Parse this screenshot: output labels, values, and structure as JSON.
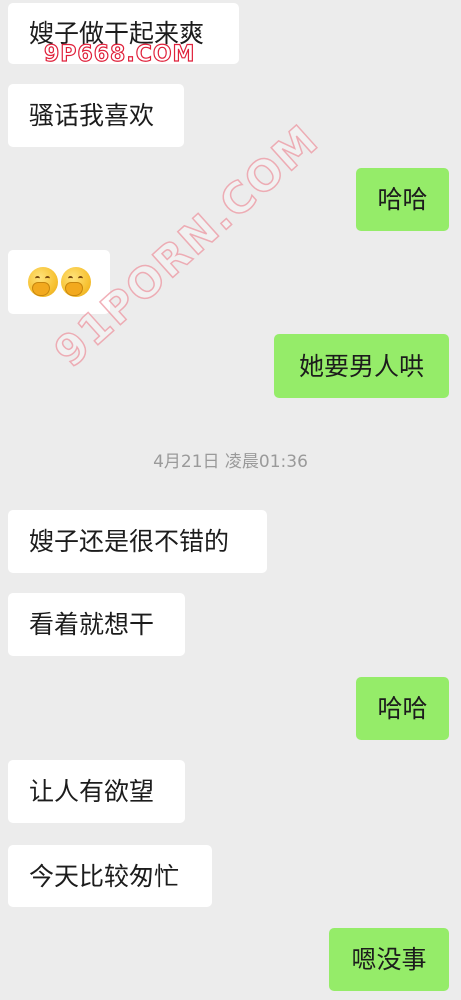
{
  "messages": [
    {
      "side": "in",
      "text": "嫂子做干起来爽"
    },
    {
      "side": "in",
      "text": "骚话我喜欢"
    },
    {
      "side": "out",
      "text": "哈哈"
    },
    {
      "side": "in",
      "emoji": [
        "hand-over-mouth-emoji",
        "hand-over-mouth-emoji"
      ]
    },
    {
      "side": "out",
      "text": "她要男人哄"
    },
    {
      "side": "in",
      "text": "嫂子还是很不错的"
    },
    {
      "side": "in",
      "text": "看着就想干"
    },
    {
      "side": "out",
      "text": "哈哈"
    },
    {
      "side": "in",
      "text": "让人有欲望"
    },
    {
      "side": "in",
      "text": "今天比较匆忙"
    },
    {
      "side": "out",
      "text": "嗯没事"
    }
  ],
  "timestamp": "4月21日 凌晨01:36",
  "watermarks": {
    "top": "9P668.COM",
    "diagonal": "91PORN.COM"
  },
  "colors": {
    "background": "#ececec",
    "incoming_bubble": "#ffffff",
    "outgoing_bubble": "#95ec69",
    "timestamp_text": "#9a9a9a",
    "watermark_red": "#e0213b"
  }
}
